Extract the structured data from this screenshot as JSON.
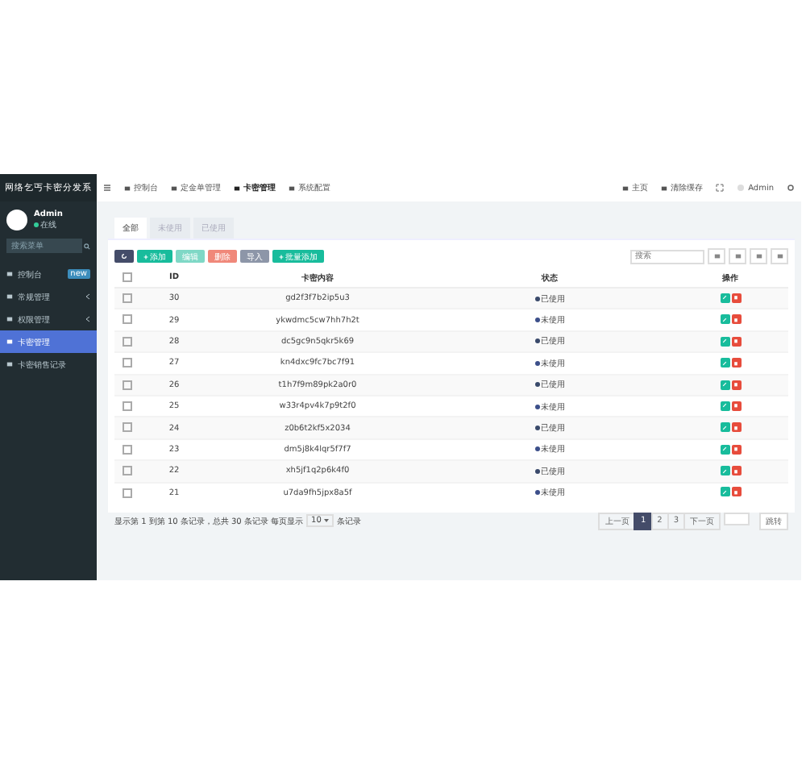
{
  "app": {
    "title": "网络乞丐卡密分发系"
  },
  "topnav": {
    "tabs": [
      {
        "label": "控制台",
        "selected": false
      },
      {
        "label": "定金单管理",
        "selected": false
      },
      {
        "label": "卡密管理",
        "selected": true
      },
      {
        "label": "系统配置",
        "selected": false
      }
    ],
    "links": [
      "主页",
      "清除缓存"
    ],
    "user": "Admin"
  },
  "sidebar": {
    "user": {
      "name": "Admin",
      "status": "在线"
    },
    "search": {
      "placeholder": "搜索菜单"
    },
    "items": [
      {
        "label": "控制台",
        "badge": "new",
        "expandable": false,
        "selected": false
      },
      {
        "label": "常规管理",
        "expandable": true,
        "selected": false
      },
      {
        "label": "权限管理",
        "expandable": true,
        "selected": false
      },
      {
        "label": "卡密管理",
        "expandable": false,
        "selected": true
      },
      {
        "label": "卡密销售记录",
        "expandable": false,
        "selected": false
      }
    ]
  },
  "tabs": [
    {
      "label": "全部",
      "selected": true
    },
    {
      "label": "未使用",
      "selected": false
    },
    {
      "label": "已使用",
      "selected": false
    }
  ],
  "toolbar": [
    {
      "kind": "refresh"
    },
    {
      "kind": "add",
      "label": "添加"
    },
    {
      "kind": "edit",
      "label": "编辑"
    },
    {
      "kind": "delete",
      "label": "删除"
    },
    {
      "kind": "import",
      "label": "导入"
    },
    {
      "kind": "add",
      "label": "批量添加"
    }
  ],
  "search": {
    "placeholder": "搜索"
  },
  "table": {
    "all_checked": false,
    "columns": [
      "ID",
      "卡密内容",
      "状态",
      "操作"
    ],
    "rows": [
      {
        "id": "30",
        "code": "gd2f3f7b2ip5u3",
        "status": "已使用",
        "used": true,
        "checked": false
      },
      {
        "id": "29",
        "code": "ykwdmc5cw7hh7h2t",
        "status": "未使用",
        "used": false,
        "checked": false
      },
      {
        "id": "28",
        "code": "dc5gc9n5qkr5k69",
        "status": "已使用",
        "used": true,
        "checked": false
      },
      {
        "id": "27",
        "code": "kn4dxc9fc7bc7f91",
        "status": "未使用",
        "used": false,
        "checked": false
      },
      {
        "id": "26",
        "code": "t1h7f9m89pk2a0r0",
        "status": "已使用",
        "used": true,
        "checked": false
      },
      {
        "id": "25",
        "code": "w33r4pv4k7p9t2f0",
        "status": "未使用",
        "used": false,
        "checked": false
      },
      {
        "id": "24",
        "code": "z0b6t2kf5x2034",
        "status": "已使用",
        "used": true,
        "checked": false
      },
      {
        "id": "23",
        "code": "dm5j8k4lqr5f7f7",
        "status": "未使用",
        "used": false,
        "checked": false
      },
      {
        "id": "22",
        "code": "xh5jf1q2p6k4f0",
        "status": "已使用",
        "used": true,
        "checked": false
      },
      {
        "id": "21",
        "code": "u7da9fh5jpx8a5f",
        "status": "未使用",
        "used": false,
        "checked": false
      }
    ]
  },
  "footer": {
    "before": "显示第 1 到第 10 条记录，总共 30 条记录 每页显示",
    "page_size": "10",
    "after": "条记录"
  },
  "pagination": {
    "prev": "上一页",
    "pages": [
      {
        "label": "1",
        "selected": true
      },
      {
        "label": "2",
        "selected": false
      },
      {
        "label": "3",
        "selected": false
      }
    ],
    "next": "下一页",
    "jump": "跳转"
  }
}
